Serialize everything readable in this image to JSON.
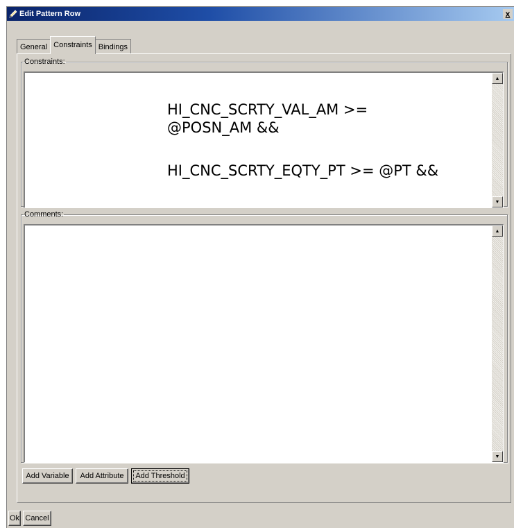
{
  "window": {
    "title": "Edit Pattern Row",
    "close_label": "x"
  },
  "tabs": [
    {
      "label": "General",
      "active": false
    },
    {
      "label": "Constraints",
      "active": true
    },
    {
      "label": "Bindings",
      "active": false
    }
  ],
  "constraints": {
    "legend": "Constraints:",
    "lines": [
      "HI_CNC_SCRTY_VAL_AM >= @POSN_AM &&",
      "HI_CNC_SCRTY_EQTY_PT >= @PT &&"
    ]
  },
  "comments": {
    "legend": "Comments:",
    "value": ""
  },
  "actions": {
    "add_variable": "Add Variable",
    "add_attribute": "Add Attribute",
    "add_threshold": "Add Threshold"
  },
  "dialog_buttons": {
    "ok": "Ok",
    "cancel": "Cancel"
  },
  "icons": {
    "title": "pencil-icon",
    "scroll_up": "scroll-up-arrow-icon",
    "scroll_down": "scroll-down-arrow-icon"
  },
  "colors": {
    "title_bar": "#0a246a",
    "face": "#d4d0c8"
  }
}
